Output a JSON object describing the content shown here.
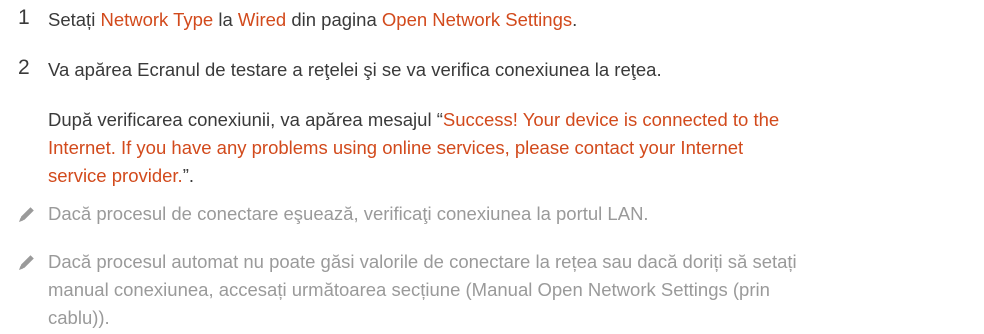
{
  "step1": {
    "number": "1",
    "t1": "Setați ",
    "network_type": "Network Type",
    "t2": " la ",
    "wired": "Wired",
    "t3": " din pagina ",
    "open_settings": "Open Network Settings",
    "t4": "."
  },
  "step2": {
    "number": "2",
    "line": "Va apărea Ecranul de testare a reţelei şi se va verifica conexiunea la reţea.",
    "p_start": "După verificarea conexiunii, va apărea mesajul “",
    "msg_l1": "Success! Your device is connected to the",
    "msg_l2": "Internet. If you have any problems using online services, please contact your Internet",
    "msg_l3": "service provider.",
    "p_end": "”."
  },
  "notes": [
    {
      "icon": "pencil-icon",
      "lines": [
        "Dacă procesul de conectare eşuează, verificaţi conexiunea la portul LAN."
      ]
    },
    {
      "icon": "pencil-icon",
      "lines": [
        "Dacă procesul automat nu poate găsi valorile de conectare la rețea sau dacă doriți să setați",
        "manual conexiunea, accesați următoarea secțiune (Manual Open Network Settings (prin",
        "cablu))."
      ]
    }
  ],
  "colors": {
    "accent": "#d24a1c",
    "body": "#3a3a3a",
    "note": "#9a9a9a"
  }
}
